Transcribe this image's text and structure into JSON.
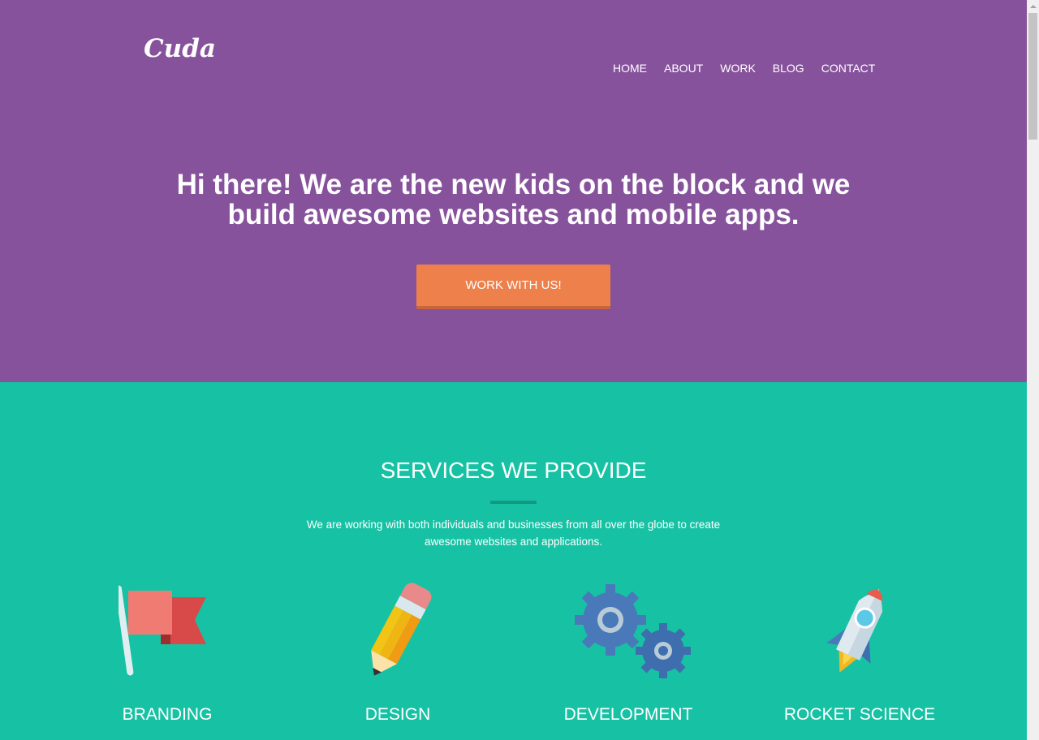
{
  "brand": {
    "logo_text": "Cuda"
  },
  "nav": {
    "items": [
      {
        "label": "HOME"
      },
      {
        "label": "ABOUT"
      },
      {
        "label": "WORK"
      },
      {
        "label": "BLOG"
      },
      {
        "label": "CONTACT"
      }
    ]
  },
  "hero": {
    "headline_line1": "Hi there! We are the new kids on the block and we",
    "headline_line2": "build awesome websites and mobile apps.",
    "cta_label": "WORK WITH US!"
  },
  "services": {
    "title": "SERVICES WE PROVIDE",
    "description": "We are working with both individuals and businesses from all over the globe to create awesome websites and applications.",
    "items": [
      {
        "label": "BRANDING",
        "icon": "flag-icon"
      },
      {
        "label": "DESIGN",
        "icon": "pencil-icon"
      },
      {
        "label": "DEVELOPMENT",
        "icon": "gears-icon"
      },
      {
        "label": "ROCKET SCIENCE",
        "icon": "rocket-icon"
      }
    ]
  },
  "colors": {
    "hero_bg": "#87529c",
    "services_bg": "#17c2a4",
    "cta_bg": "#ed804b",
    "divider": "#12997f"
  }
}
